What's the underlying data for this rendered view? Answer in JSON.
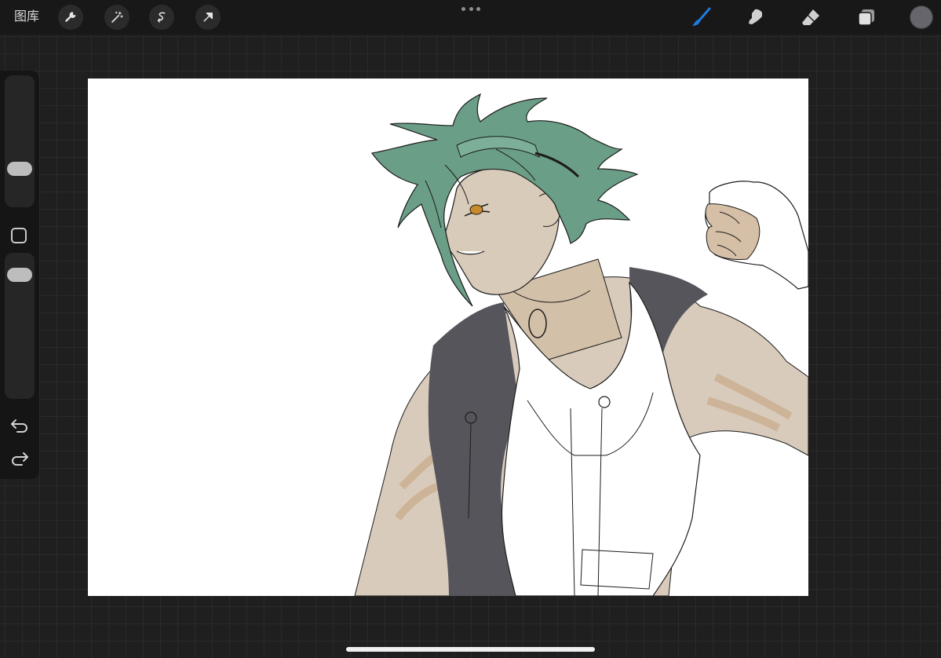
{
  "topbar": {
    "gallery_label": "图库",
    "left_tools": [
      {
        "icon": "wrench-icon",
        "name": "actions"
      },
      {
        "icon": "magic-wand-icon",
        "name": "adjustments"
      },
      {
        "icon": "selection-icon",
        "name": "selection"
      },
      {
        "icon": "transform-arrow-icon",
        "name": "transform"
      }
    ],
    "right_tools": [
      {
        "icon": "brush-icon",
        "name": "paint",
        "active": true,
        "color": "#1f7ae0"
      },
      {
        "icon": "smudge-icon",
        "name": "smudge",
        "active": false,
        "color": "#d0d0d0"
      },
      {
        "icon": "eraser-icon",
        "name": "eraser",
        "active": false,
        "color": "#d0d0d0"
      },
      {
        "icon": "layers-icon",
        "name": "layers",
        "active": false,
        "color": "#d0d0d0"
      }
    ],
    "current_color": "#66656b"
  },
  "sidebar": {
    "brush_size_level": 0.3,
    "opacity_level": 0.1,
    "undo_icon": "undo-icon",
    "redo_icon": "redo-icon"
  },
  "canvas": {
    "background": "#ffffff",
    "artwork": "illustration-green-haired-character"
  },
  "colors": {
    "hair": "#6a9e86",
    "skin": "#d6c7b4",
    "skin_shadow": "#c4a07a",
    "vest_dark": "#55545a",
    "line": "#1c1c1c"
  }
}
